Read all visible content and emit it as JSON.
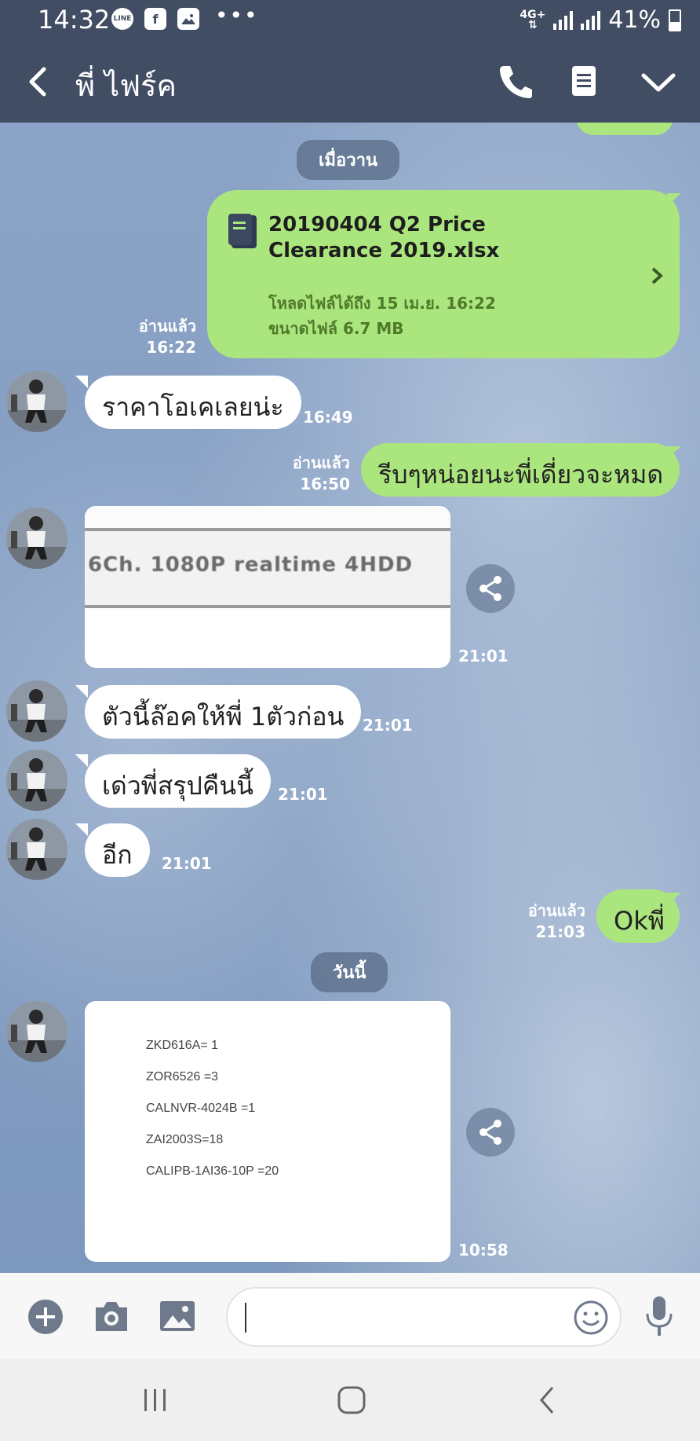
{
  "status_bar": {
    "time": "14:32",
    "network": "4G+",
    "battery": "41%",
    "battery_level": 0.41
  },
  "header": {
    "contact_name": "พี่ ไฟร์ค"
  },
  "chat": {
    "date_yesterday": "เมื่อวาน",
    "file_message": {
      "name": "20190404 Q2 Price Clearance 2019.xlsx",
      "expiry": "โหลดไฟล์ได้ถึง 15 เม.ย. 16:22",
      "size": "ขนาดไฟล์ 6.7 MB",
      "read": "อ่านแล้ว",
      "time": "16:22"
    },
    "msg1": {
      "text": "ราคาโอเคเลยน่ะ",
      "time": "16:49"
    },
    "msg2": {
      "text": "รีบๆหน่อยนะพี่เดี่ยวจะหมด",
      "read": "อ่านแล้ว",
      "time": "16:50"
    },
    "image1": {
      "text": "6Ch. 1080P realtime 4HDD",
      "time": "21:01"
    },
    "msg3": {
      "text": "ตัวนี้ล๊อคให้พี่ 1ตัวก่อน",
      "time": "21:01"
    },
    "msg4": {
      "text": "เด่วพี่สรุปคืนนี้",
      "time": "21:01"
    },
    "msg5": {
      "text": "อีก",
      "time": "21:01"
    },
    "msg6": {
      "text": "Okพี่",
      "read": "อ่านแล้ว",
      "time": "21:03"
    },
    "date_today": "วันนี้",
    "image2": {
      "lines": [
        "ZKD616A= 1",
        "ZOR6526 =3",
        "CALNVR-4024B =1",
        "ZAI2003S=18",
        "CALIPB-1AI36-10P =20"
      ],
      "time": "10:58"
    }
  },
  "colors": {
    "header": "#414d63",
    "outgoing_bubble": "#abe57e",
    "incoming_bubble": "#ffffff",
    "chat_background": "#8aa3c6"
  }
}
